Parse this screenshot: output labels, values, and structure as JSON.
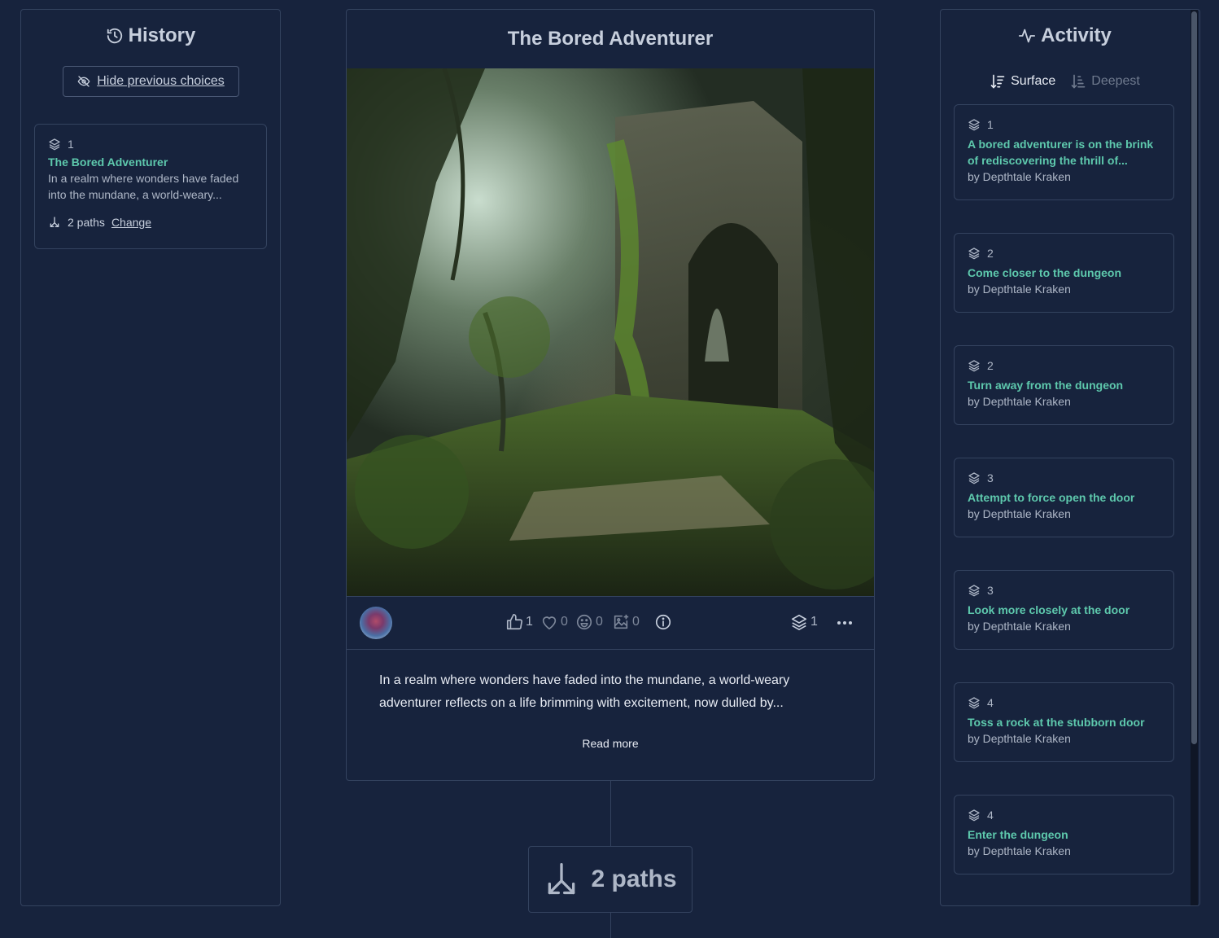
{
  "history": {
    "title": "History",
    "hide_label": "Hide previous choices",
    "card": {
      "depth": "1",
      "title": "The Bored Adventurer",
      "desc_line1": "In a realm where wonders have faded",
      "desc_line2": "into the mundane, a world-weary...",
      "paths": "2 paths",
      "change": "Change"
    }
  },
  "story": {
    "title": "The Bored Adventurer",
    "image": "jungle-ruins-illustration",
    "likes": "1",
    "favorites": "0",
    "reactions": "0",
    "images": "0",
    "depth": "1",
    "text_line1": "In a realm where wonders have faded into the mundane, a world-weary",
    "text_line2": "adventurer reflects on a life brimming with excitement, now dulled by...",
    "read_more": "Read more"
  },
  "paths_box": {
    "label": "2 paths"
  },
  "activity": {
    "title": "Activity",
    "sort_surface": "Surface",
    "sort_deepest": "Deepest",
    "items": [
      {
        "depth": "1",
        "title_line1": "A bored adventurer is on the brink",
        "title_line2": "of rediscovering the thrill of...",
        "by": "by Depthtale Kraken"
      },
      {
        "depth": "2",
        "title": "Come closer to the dungeon",
        "by": "by Depthtale Kraken"
      },
      {
        "depth": "2",
        "title": "Turn away from the dungeon",
        "by": "by Depthtale Kraken"
      },
      {
        "depth": "3",
        "title": "Attempt to force open the door",
        "by": "by Depthtale Kraken"
      },
      {
        "depth": "3",
        "title": "Look more closely at the door",
        "by": "by Depthtale Kraken"
      },
      {
        "depth": "4",
        "title": "Toss a rock at the stubborn door",
        "by": "by Depthtale Kraken"
      },
      {
        "depth": "4",
        "title": "Enter the dungeon",
        "by": "by Depthtale Kraken"
      }
    ]
  },
  "colors": {
    "background": "#17233d",
    "accent": "#5ec9ad",
    "border": "#34435f"
  }
}
